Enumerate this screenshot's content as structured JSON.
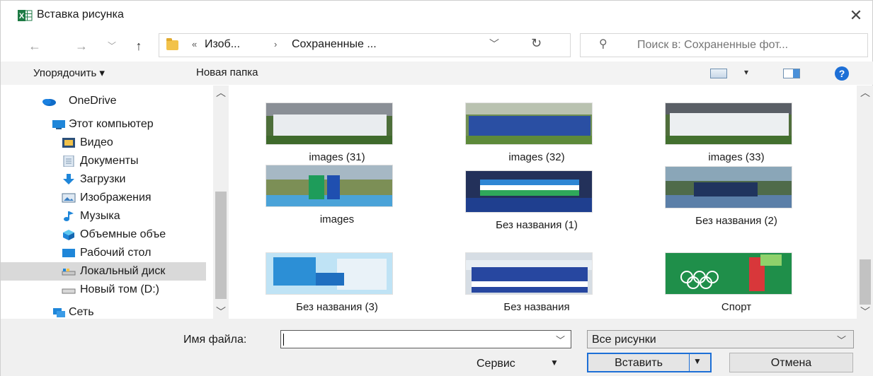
{
  "window": {
    "title": "Вставка рисунка",
    "app_icon": "excel-icon",
    "close_icon": "close-icon"
  },
  "nav": {
    "back_icon": "back-arrow-icon",
    "forward_icon": "forward-arrow-icon",
    "recent_icon": "recent-locations-icon",
    "up_icon": "up-arrow-icon",
    "address": {
      "overflow": "«",
      "segments": [
        "Изоб...",
        "Сохраненные ..."
      ],
      "separator": "›"
    },
    "refresh_icon": "refresh-icon",
    "search_placeholder": "Поиск в: Сохраненные фот..."
  },
  "toolbar": {
    "organize_label": "Упорядочить ▾",
    "new_folder_label": "Новая папка",
    "view_icon": "change-view-icon",
    "preview_icon": "preview-pane-icon",
    "help_icon": "?"
  },
  "sidebar": {
    "items": [
      {
        "label": "OneDrive",
        "icon": "onedrive-icon",
        "selected": false
      },
      {
        "label": "Этот компьютер",
        "icon": "computer-icon",
        "selected": false
      },
      {
        "label": "Видео",
        "icon": "video-folder-icon",
        "selected": false
      },
      {
        "label": "Документы",
        "icon": "documents-folder-icon",
        "selected": false
      },
      {
        "label": "Загрузки",
        "icon": "downloads-folder-icon",
        "selected": false
      },
      {
        "label": "Изображения",
        "icon": "pictures-folder-icon",
        "selected": false
      },
      {
        "label": "Музыка",
        "icon": "music-folder-icon",
        "selected": false
      },
      {
        "label": "Объемные объе",
        "icon": "3d-objects-folder-icon",
        "selected": false
      },
      {
        "label": "Рабочий стол",
        "icon": "desktop-folder-icon",
        "selected": false
      },
      {
        "label": "Локальный диск",
        "icon": "local-disk-icon",
        "selected": true
      },
      {
        "label": "Новый том (D:)",
        "icon": "drive-icon",
        "selected": false
      },
      {
        "label": "Сеть",
        "icon": "network-icon",
        "selected": false
      }
    ]
  },
  "files": [
    {
      "name": "images (31)"
    },
    {
      "name": "images (32)"
    },
    {
      "name": "images (33)"
    },
    {
      "name": "images"
    },
    {
      "name": "Без названия (1)"
    },
    {
      "name": "Без названия (2)"
    },
    {
      "name": "Без названия (3)"
    },
    {
      "name": "Без названия"
    },
    {
      "name": "Спорт"
    }
  ],
  "bottom": {
    "filename_label": "Имя файла:",
    "filename_value": "",
    "filetype_value": "Все рисунки",
    "tools_label": "Сервис",
    "insert_label": "Вставить",
    "cancel_label": "Отмена"
  },
  "colors": {
    "accent": "#1d6fd6",
    "selection": "#d9d9d9",
    "toolbar_bg": "#f3f3f3",
    "footer_bg": "#f0f0f0"
  }
}
